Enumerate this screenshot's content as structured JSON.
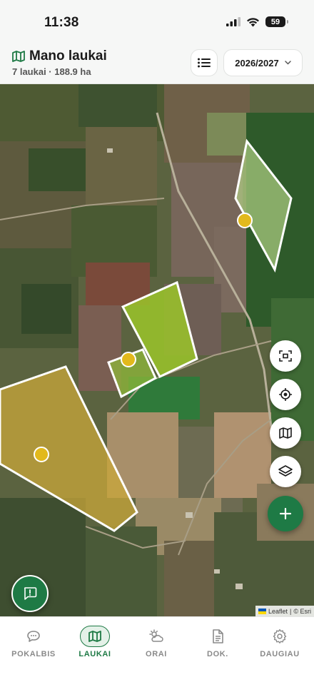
{
  "status": {
    "time": "11:38",
    "battery": "59"
  },
  "header": {
    "title": "Mano laukai",
    "subtitle": "7 laukai · 188.9 ha",
    "season": "2026/2027"
  },
  "map": {
    "fields": [
      {
        "name": "north-east-field",
        "color": "#b9d98a"
      },
      {
        "name": "center-field",
        "color": "#9bc42a"
      },
      {
        "name": "small-field",
        "color": "#8fb83a"
      },
      {
        "name": "west-field",
        "color": "#c9a73a"
      }
    ],
    "marker_color": "#e2b91c",
    "attribution": {
      "leaflet": "Leaflet",
      "separator": "|",
      "esri": "© Esri"
    }
  },
  "nav": {
    "items": [
      {
        "label": "POKALBIS",
        "icon": "chat-bubble-icon"
      },
      {
        "label": "LAUKAI",
        "icon": "map-icon",
        "active": true
      },
      {
        "label": "ORAI",
        "icon": "weather-icon"
      },
      {
        "label": "DOK.",
        "icon": "document-icon"
      },
      {
        "label": "DAUGIAU",
        "icon": "gear-icon"
      }
    ]
  },
  "colors": {
    "accent": "#1e7a45",
    "accent_light": "#e4f1e8"
  }
}
